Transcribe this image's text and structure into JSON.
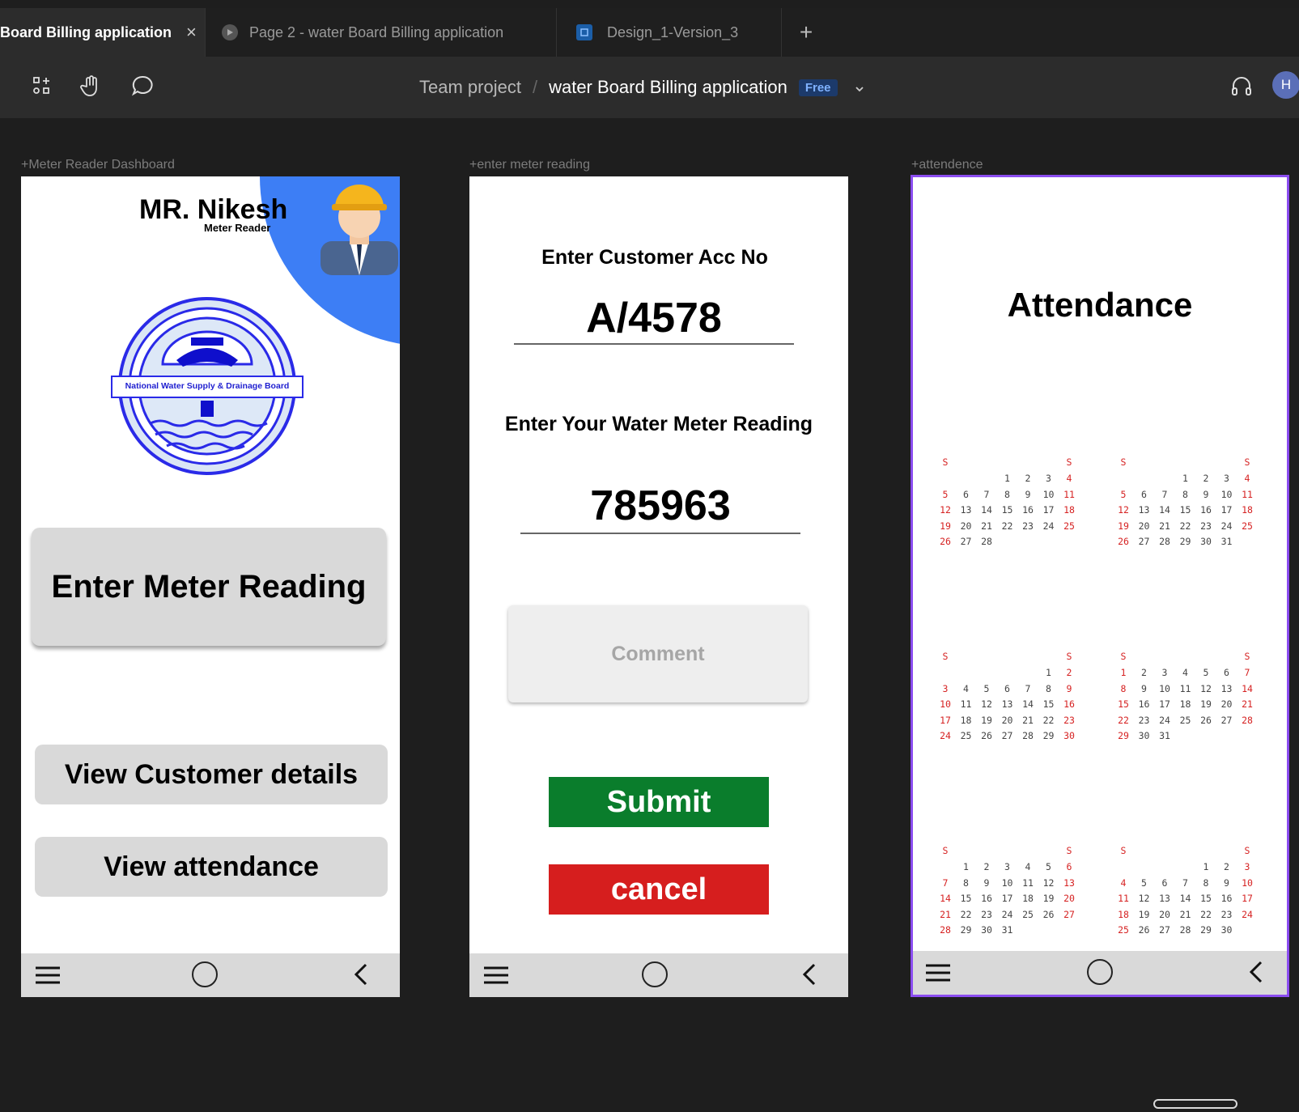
{
  "tabs": [
    {
      "label": "Board Billing application",
      "close": "×",
      "active": true
    },
    {
      "label": "Page 2 - water Board Billing application",
      "active": false
    },
    {
      "label": "Design_1-Version_3",
      "active": false
    }
  ],
  "new_tab": "+",
  "toolbar": {
    "breadcrumb_root": "Team project",
    "separator": "/",
    "project_name": "water Board Billing application",
    "plan_badge": "Free",
    "avatar_initial": "H"
  },
  "frames": {
    "dashboard": {
      "label": "+Meter Reader Dashboard",
      "user_name": "MR. Nikesh",
      "user_role": "Meter Reader",
      "logo_text": "National Water Supply & Drainage Board",
      "btn_enter_reading": "Enter Meter Reading",
      "btn_view_customer": "View Customer details",
      "btn_view_attendance": "View attendance"
    },
    "meter": {
      "label": "+enter meter reading",
      "acc_label": "Enter Customer Acc No",
      "acc_value": "A/4578",
      "reading_label": "Enter Your Water Meter Reading",
      "reading_value": "785963",
      "comment_placeholder": "Comment",
      "submit_label": "Submit",
      "cancel_label": "cancel"
    },
    "attendance": {
      "label": "+attendence",
      "title": "Attendance",
      "weekend_marker": "S",
      "months": [
        {
          "start": 3,
          "days": 28
        },
        {
          "start": 3,
          "days": 31
        },
        {
          "start": 5,
          "days": 30
        },
        {
          "start": 0,
          "days": 31
        },
        {
          "start": 1,
          "days": 31
        },
        {
          "start": 4,
          "days": 30
        }
      ]
    }
  },
  "colors": {
    "accent_blue": "#3d7ef5",
    "submit_green": "#0a7d2c",
    "cancel_red": "#d61e1e",
    "selection_purple": "#8b4df0"
  }
}
